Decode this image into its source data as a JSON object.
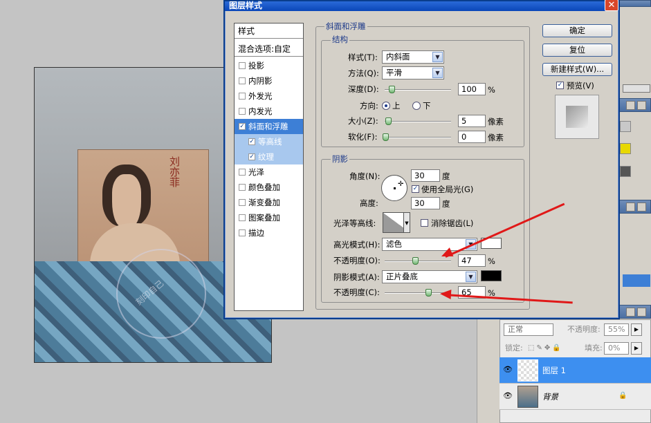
{
  "dialog": {
    "title": "图层样式",
    "close_glyph": "✕",
    "style_list": {
      "header": "样式",
      "blend_options": "混合选项:自定",
      "items": [
        "投影",
        "内阴影",
        "外发光",
        "内发光",
        "斜面和浮雕",
        "等高线",
        "纹理",
        "光泽",
        "颜色叠加",
        "渐变叠加",
        "图案叠加",
        "描边"
      ],
      "checked": [
        "斜面和浮雕",
        "等高线",
        "纹理"
      ],
      "selected": "斜面和浮雕"
    },
    "bevel": {
      "title": "斜面和浮雕",
      "structure_title": "结构",
      "style_label": "样式(T):",
      "style_value": "内斜面",
      "technique_label": "方法(Q):",
      "technique_value": "平滑",
      "depth_label": "深度(D):",
      "depth_value": "100",
      "depth_unit": "%",
      "direction_label": "方向:",
      "dir_up": "上",
      "dir_down": "下",
      "size_label": "大小(Z):",
      "size_value": "5",
      "size_unit": "像素",
      "soften_label": "软化(F):",
      "soften_value": "0",
      "soften_unit": "像素"
    },
    "shading": {
      "title": "阴影",
      "angle_label": "角度(N):",
      "angle_value": "30",
      "angle_unit": "度",
      "global_light": "使用全局光(G)",
      "altitude_label": "高度:",
      "altitude_value": "30",
      "altitude_unit": "度",
      "gloss_label": "光泽等高线:",
      "antialias": "消除锯齿(L)",
      "highlight_mode_label": "高光模式(H):",
      "highlight_mode_value": "滤色",
      "highlight_color": "#ffffff",
      "highlight_opacity_label": "不透明度(O):",
      "highlight_opacity_value": "47",
      "highlight_opacity_unit": "%",
      "shadow_mode_label": "阴影模式(A):",
      "shadow_mode_value": "正片叠底",
      "shadow_color": "#000000",
      "shadow_opacity_label": "不透明度(C):",
      "shadow_opacity_value": "65",
      "shadow_opacity_unit": "%"
    },
    "buttons": {
      "ok": "确定",
      "reset": "复位",
      "new_style": "新建样式(W)...",
      "preview": "预览(V)"
    }
  },
  "canvas": {
    "poster_text": "刘亦菲",
    "stamp_text": "刻印自己"
  },
  "layers_panel": {
    "blend_mode": "正常",
    "opacity_label": "不透明度:",
    "opacity_value": "55%",
    "lock_label": "锁定:",
    "fill_label": "填充:",
    "fill_value": "0%",
    "layers": [
      {
        "name": "图层 1",
        "selected": true
      },
      {
        "name": "背景",
        "selected": false,
        "locked": true
      }
    ]
  },
  "colors": {
    "selection": "#3d7fd6",
    "annotation_arrow": "#e01818"
  }
}
